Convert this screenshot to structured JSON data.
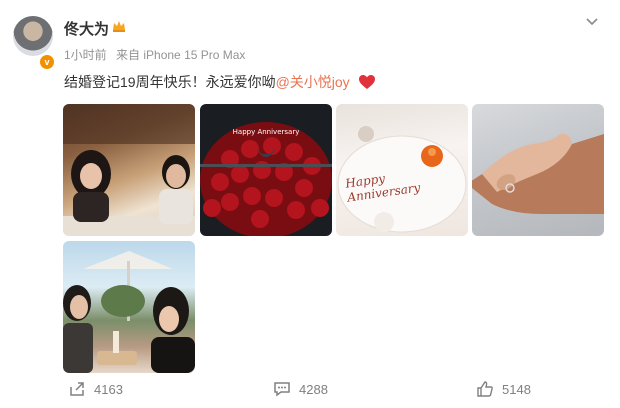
{
  "post": {
    "author": "佟大为",
    "time": "1小时前",
    "source": "来自 iPhone 15 Pro Max",
    "text": "结婚登记19周年快乐！永远爱你呦",
    "mention": "@关小悦joy",
    "photos": [
      {
        "label": "couple-dinner-photo"
      },
      {
        "label": "roses-bouquet-photo"
      },
      {
        "label": "anniversary-dessert-plate-photo",
        "plate_text": "Happy Anniversary"
      },
      {
        "label": "holding-hands-photo"
      },
      {
        "label": "couple-terrace-photo"
      }
    ]
  },
  "actions": {
    "share_count": "4163",
    "comment_count": "4288",
    "like_count": "5148"
  },
  "colors": {
    "mention": "#eb7350",
    "verified_badge": "#f29100",
    "heart": "#e0313c"
  }
}
